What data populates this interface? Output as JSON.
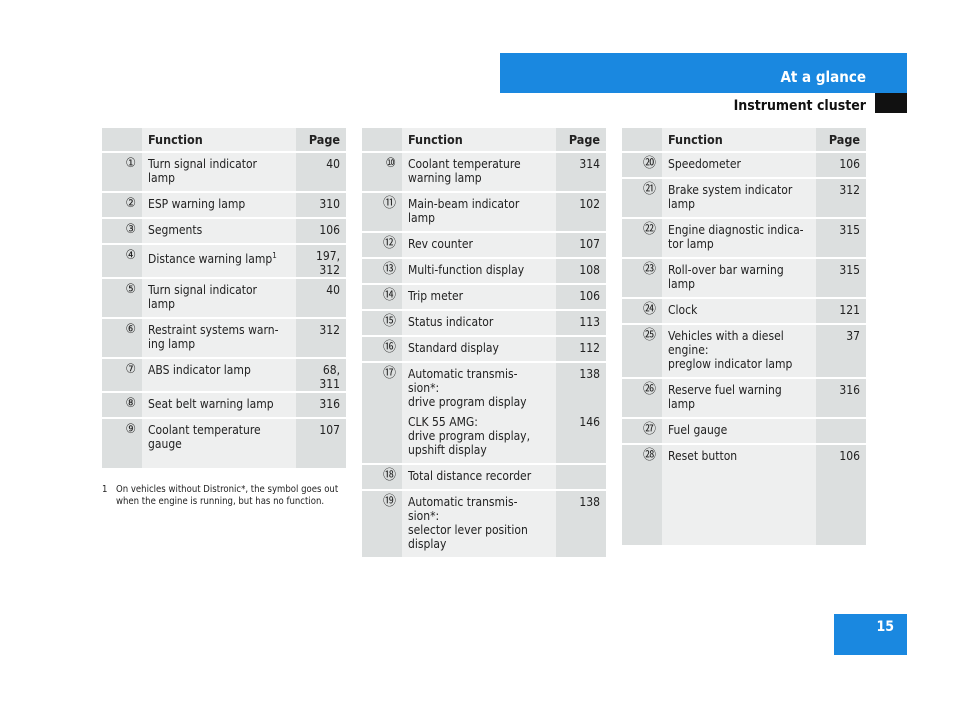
{
  "header": {
    "section": "At a glance",
    "subsection": "Instrument cluster"
  },
  "page_number": "15",
  "colors": {
    "accent": "#1a88e0",
    "cell_dark": "#dcdfdf",
    "cell_light": "#eeefef"
  },
  "tables": [
    {
      "col_function": "Function",
      "col_page": "Page",
      "rows": [
        {
          "num": "①",
          "segments": [
            {
              "text": "Turn signal indicator\nlamp",
              "page": "40"
            }
          ]
        },
        {
          "num": "②",
          "segments": [
            {
              "text": "ESP warning lamp",
              "page": "310"
            }
          ]
        },
        {
          "num": "③",
          "segments": [
            {
              "text": "Segments",
              "page": "106"
            }
          ]
        },
        {
          "num": "④",
          "segments": [
            {
              "text": "Distance warning lamp",
              "sup": "1",
              "page": "197,\n312"
            }
          ]
        },
        {
          "num": "⑤",
          "segments": [
            {
              "text": "Turn signal indicator\nlamp",
              "page": "40"
            }
          ]
        },
        {
          "num": "⑥",
          "segments": [
            {
              "text": "Restraint systems warn-\ning lamp",
              "page": "312"
            }
          ]
        },
        {
          "num": "⑦",
          "segments": [
            {
              "text": "ABS indicator lamp",
              "page": "68,\n311"
            }
          ]
        },
        {
          "num": "⑧",
          "segments": [
            {
              "text": "Seat belt warning lamp",
              "page": "316"
            }
          ]
        },
        {
          "num": "⑨",
          "segments": [
            {
              "text": "Coolant temperature\ngauge",
              "page": "107"
            }
          ]
        }
      ]
    },
    {
      "col_function": "Function",
      "col_page": "Page",
      "rows": [
        {
          "num": "⑩",
          "segments": [
            {
              "text": "Coolant temperature\nwarning lamp",
              "page": "314"
            }
          ]
        },
        {
          "num": "⑪",
          "segments": [
            {
              "text": "Main-beam indicator\nlamp",
              "page": "102"
            }
          ]
        },
        {
          "num": "⑫",
          "segments": [
            {
              "text": "Rev counter",
              "page": "107"
            }
          ]
        },
        {
          "num": "⑬",
          "segments": [
            {
              "text": "Multi-function display",
              "page": "108"
            }
          ]
        },
        {
          "num": "⑭",
          "segments": [
            {
              "text": "Trip meter",
              "page": "106"
            }
          ]
        },
        {
          "num": "⑮",
          "segments": [
            {
              "text": "Status indicator",
              "page": "113"
            }
          ]
        },
        {
          "num": "⑯",
          "segments": [
            {
              "text": "Standard display",
              "page": "112"
            }
          ]
        },
        {
          "num": "⑰",
          "segments": [
            {
              "text": "Automatic transmis-\nsion*:\ndrive program display",
              "page": "138"
            },
            {
              "text": "CLK 55 AMG:\ndrive program display,\nupshift display",
              "page": "146"
            }
          ]
        },
        {
          "num": "⑱",
          "segments": [
            {
              "text": "Total distance recorder",
              "page": ""
            }
          ]
        },
        {
          "num": "⑲",
          "segments": [
            {
              "text": "Automatic transmis-\nsion*:\nselector lever position\ndisplay",
              "page": "138"
            }
          ]
        }
      ]
    },
    {
      "col_function": "Function",
      "col_page": "Page",
      "rows": [
        {
          "num": "⑳",
          "segments": [
            {
              "text": "Speedometer",
              "page": "106"
            }
          ]
        },
        {
          "num": "㉑",
          "segments": [
            {
              "text": "Brake system indicator\nlamp",
              "page": "312"
            }
          ]
        },
        {
          "num": "㉒",
          "segments": [
            {
              "text": "Engine diagnostic indica-\ntor lamp",
              "page": "315"
            }
          ]
        },
        {
          "num": "㉓",
          "segments": [
            {
              "text": "Roll-over bar warning\nlamp",
              "page": "315"
            }
          ]
        },
        {
          "num": "㉔",
          "segments": [
            {
              "text": "Clock",
              "page": "121"
            }
          ]
        },
        {
          "num": "㉕",
          "segments": [
            {
              "text": "Vehicles with a diesel\nengine:\npreglow indicator lamp",
              "page": "37"
            }
          ]
        },
        {
          "num": "㉖",
          "segments": [
            {
              "text": "Reserve fuel warning\nlamp",
              "page": "316"
            }
          ]
        },
        {
          "num": "㉗",
          "segments": [
            {
              "text": "Fuel gauge",
              "page": ""
            }
          ]
        },
        {
          "num": "㉘",
          "segments": [
            {
              "text": "Reset button",
              "page": "106"
            }
          ]
        }
      ]
    }
  ],
  "footnote": {
    "mark": "1",
    "text": "On vehicles without Distronic*, the symbol goes out when the engine is running, but has no function."
  }
}
